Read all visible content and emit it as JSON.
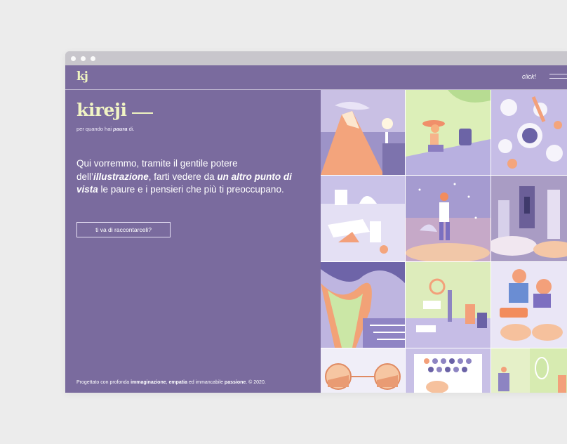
{
  "header": {
    "logo": "kj",
    "click_label": "click!"
  },
  "hero": {
    "brand": "kireji",
    "tagline_before": "per quando hai ",
    "tagline_emph": "paura",
    "tagline_after": " di.",
    "lead_1": "Qui vorremmo, tramite il gentile potere dell’",
    "lead_emph_1": "illustrazione",
    "lead_2": ", farti vedere da ",
    "lead_emph_2": "un altro punto di vista",
    "lead_3": " le paure e i pensieri che più ti preoccupano.",
    "cta_label": "ti va di raccontarceli?"
  },
  "footer": {
    "t1": "Progettato con profonda ",
    "b1": "immaginazione",
    "t2": ", ",
    "b2": "empatia",
    "t3": " ed immancabile ",
    "b3": "passione",
    "t4": ". © 2020."
  },
  "colors": {
    "page_bg": "#7a6b9e",
    "brand_accent": "#eef3c0",
    "lavender": "#c9c3e6",
    "peach": "#f3a07a",
    "mint": "#d9ecb0"
  },
  "gallery": {
    "tiles": [
      "volcano-lighthouse",
      "beach-woman",
      "dinner-table",
      "cake-table",
      "snow-girl",
      "doorway-clouds",
      "waves-staircase",
      "machine-lab",
      "hands-puzzle",
      "glasses-desert",
      "board-game",
      "mirror-room"
    ]
  }
}
